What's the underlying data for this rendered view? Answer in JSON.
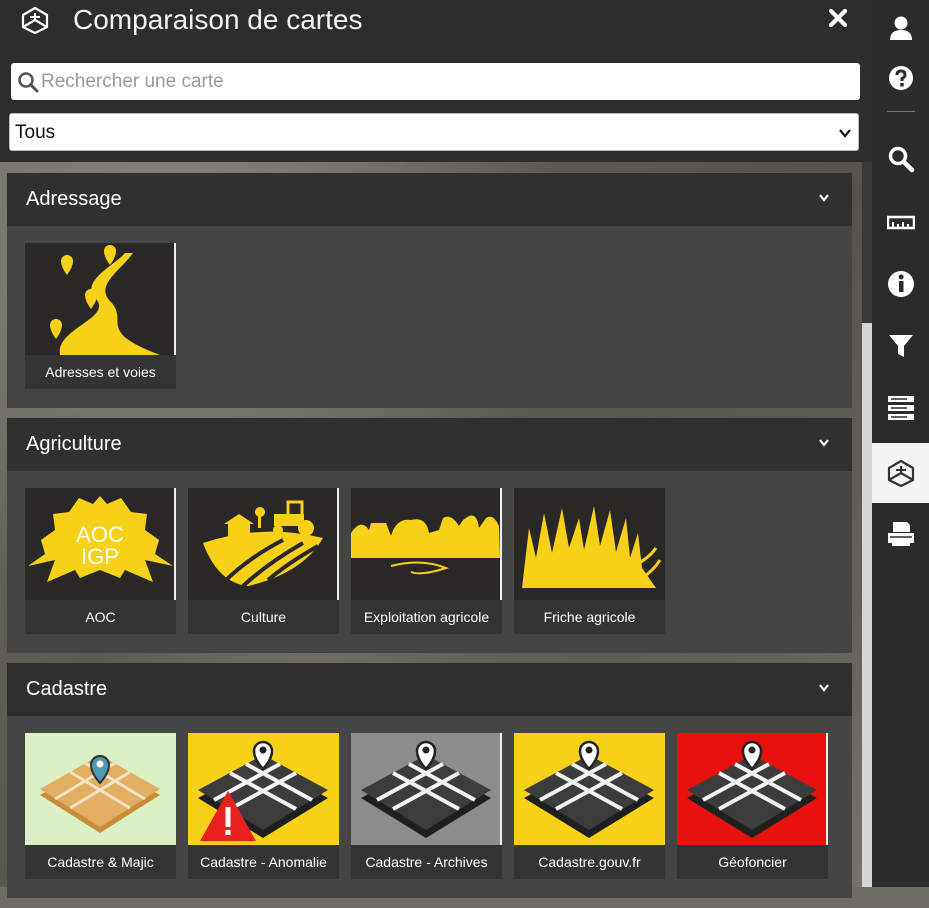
{
  "header": {
    "title": "Comparaison de cartes",
    "logo_icon": "map-compare-icon",
    "close_icon": "close-icon"
  },
  "search": {
    "placeholder": "Rechercher une carte",
    "value": "",
    "icon": "search-icon"
  },
  "filter": {
    "selected": "Tous",
    "icon": "chevron-down-icon"
  },
  "categories": [
    {
      "name": "Adressage",
      "cards": [
        {
          "label": "Adresses et voies"
        }
      ]
    },
    {
      "name": "Agriculture",
      "cards": [
        {
          "label": "AOC"
        },
        {
          "label": "Culture"
        },
        {
          "label": "Exploitation agricole"
        },
        {
          "label": "Friche agricole"
        }
      ]
    },
    {
      "name": "Cadastre",
      "cards": [
        {
          "label": "Cadastre & Majic"
        },
        {
          "label": "Cadastre - Anomalie"
        },
        {
          "label": "Cadastre - Archives"
        },
        {
          "label": "Cadastre.gouv.fr"
        },
        {
          "label": "Géofoncier"
        }
      ]
    }
  ],
  "aoc_text": {
    "line1": "AOC",
    "line2": "IGP"
  },
  "sidebar": [
    {
      "icon": "user-icon"
    },
    {
      "icon": "help-icon"
    },
    {
      "icon": "search-icon"
    },
    {
      "icon": "ruler-icon"
    },
    {
      "icon": "info-icon"
    },
    {
      "icon": "filter-icon"
    },
    {
      "icon": "layers-list-icon"
    },
    {
      "icon": "map-compare-icon",
      "active": true
    },
    {
      "icon": "print-icon"
    }
  ],
  "colors": {
    "accent_yellow": "#f7d117",
    "header_bg": "#2d2d2d",
    "category_bg": "#454545",
    "anomaly_red": "#e8211e"
  }
}
